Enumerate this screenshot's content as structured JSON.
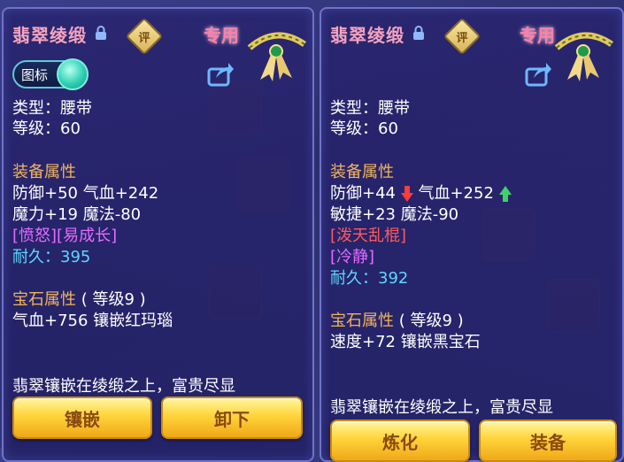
{
  "left": {
    "title": "翡翠绫缎",
    "rate_badge": "评",
    "exclusive_label": "专用",
    "icon_toggle_label": "图标",
    "type_line": "类型：腰带",
    "level_line": "等级：60",
    "equip_section": "装备属性",
    "stat1": "防御+50 气血+242",
    "stat2": "魔力+19 魔法-80",
    "special": "[愤怒][易成长]",
    "durability_label": "耐久：",
    "durability_value": "395",
    "gem_section_title": "宝石属性",
    "gem_section_level": "( 等级9 )",
    "gem_line": "气血+756 镶嵌红玛瑙",
    "description": "翡翠镶嵌在绫缎之上，富贵尽显",
    "button1": "镶嵌",
    "button2": "卸下"
  },
  "right": {
    "title": "翡翠绫缎",
    "rate_badge": "评",
    "exclusive_label": "专用",
    "type_line": "类型：腰带",
    "level_line": "等级：60",
    "equip_section": "装备属性",
    "stat1a": "防御+44",
    "stat1b": "气血+252",
    "stat2": "敏捷+23 魔法-90",
    "special1": "[泼天乱棍]",
    "special2": "[冷静]",
    "durability_label": "耐久：",
    "durability_value": "392",
    "gem_section_title": "宝石属性",
    "gem_section_level": "( 等级9 )",
    "gem_line": "速度+72 镶嵌黑宝石",
    "description": "翡翠镶嵌在绫缎之上，富贵尽显",
    "button1": "炼化",
    "button2": "装备"
  },
  "icons": {
    "lock": "lock-icon",
    "share": "share-icon",
    "item": "belt-item-icon",
    "down_arrow": "arrow-down-icon",
    "up_arrow": "arrow-up-icon"
  },
  "colors": {
    "title": "#f6a3be",
    "section": "#f1b45a",
    "special": "#e46bff",
    "durability": "#5fd7ff",
    "down": "#ff3b3b",
    "up": "#3fd26a",
    "button": "#ffd43a"
  }
}
